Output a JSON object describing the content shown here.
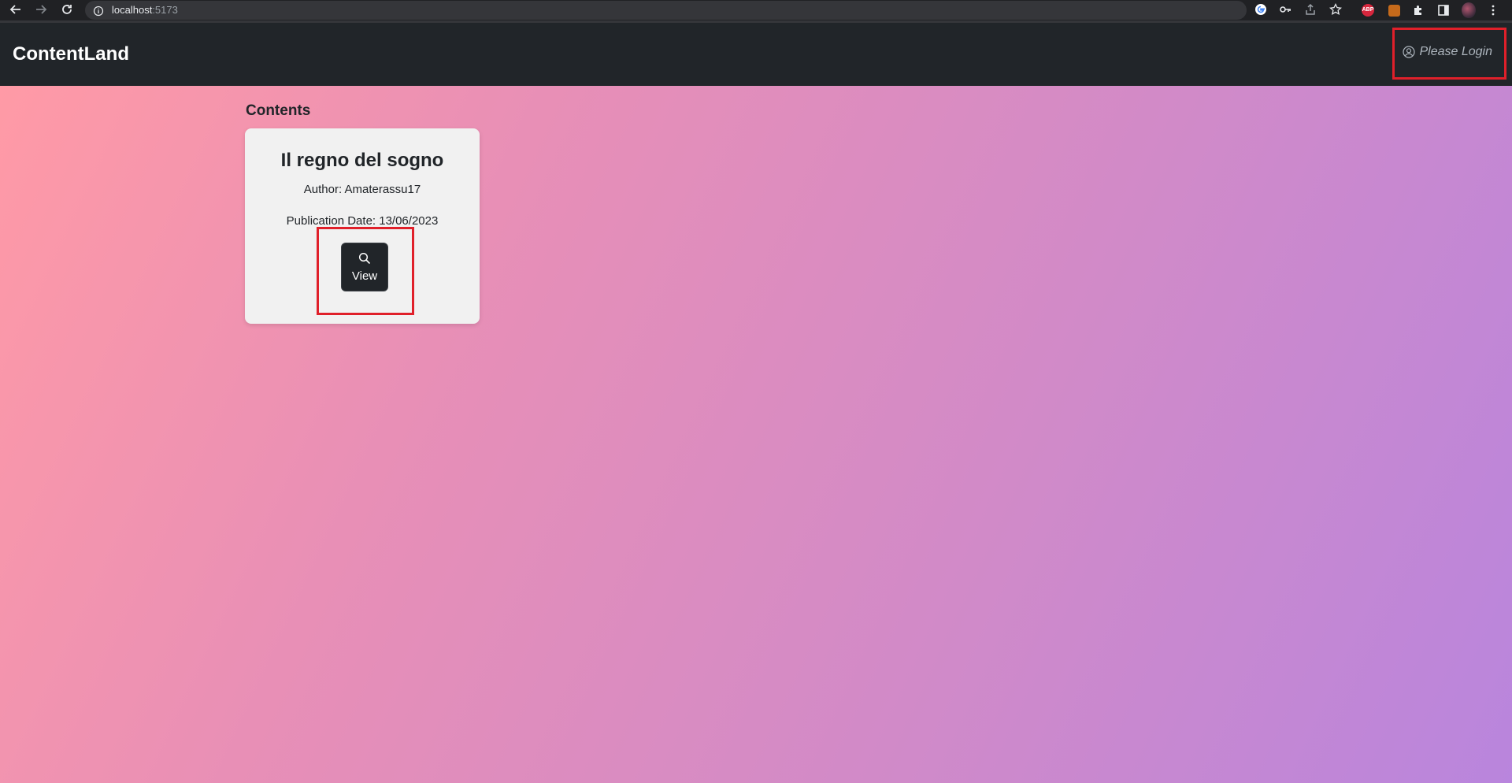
{
  "browser": {
    "url_host": "localhost",
    "url_port": ":5173",
    "extensions": {
      "abp_label": "ABP"
    }
  },
  "navbar": {
    "brand": "ContentLand",
    "login_label": "Please Login"
  },
  "main": {
    "section_title": "Contents",
    "cards": [
      {
        "title": "Il regno del sogno",
        "author": "Author: Amaterassu17",
        "publication_date": "Publication Date: 13/06/2023",
        "view_label": "View"
      }
    ]
  },
  "colors": {
    "navbar_bg": "#212529",
    "highlight": "#e0202a",
    "gradient_start": "#ff9aa6",
    "gradient_end": "#b985dd",
    "card_bg": "#f1f1f1"
  }
}
